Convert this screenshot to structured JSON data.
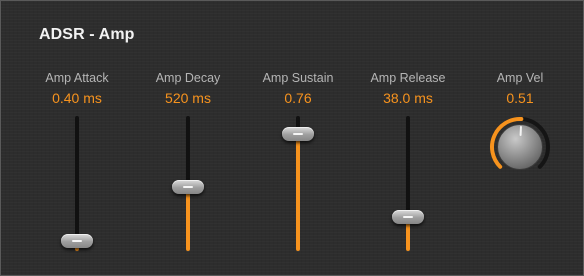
{
  "panel": {
    "title": "ADSR - Amp"
  },
  "params": [
    {
      "label": "Amp Attack",
      "value": "0.40 ms",
      "level": 0.03
    },
    {
      "label": "Amp Decay",
      "value": "520 ms",
      "level": 0.47
    },
    {
      "label": "Amp Sustain",
      "value": "0.76",
      "level": 0.9
    },
    {
      "label": "Amp Release",
      "value": "38.0 ms",
      "level": 0.23
    },
    {
      "label": "Amp Vel",
      "value": "0.51",
      "level": 0.51
    }
  ],
  "colors": {
    "accent": "#f7931e",
    "background": "#2d2d2d",
    "track": "#111111",
    "label": "#b5b5b5",
    "title": "#f2f2f2"
  }
}
